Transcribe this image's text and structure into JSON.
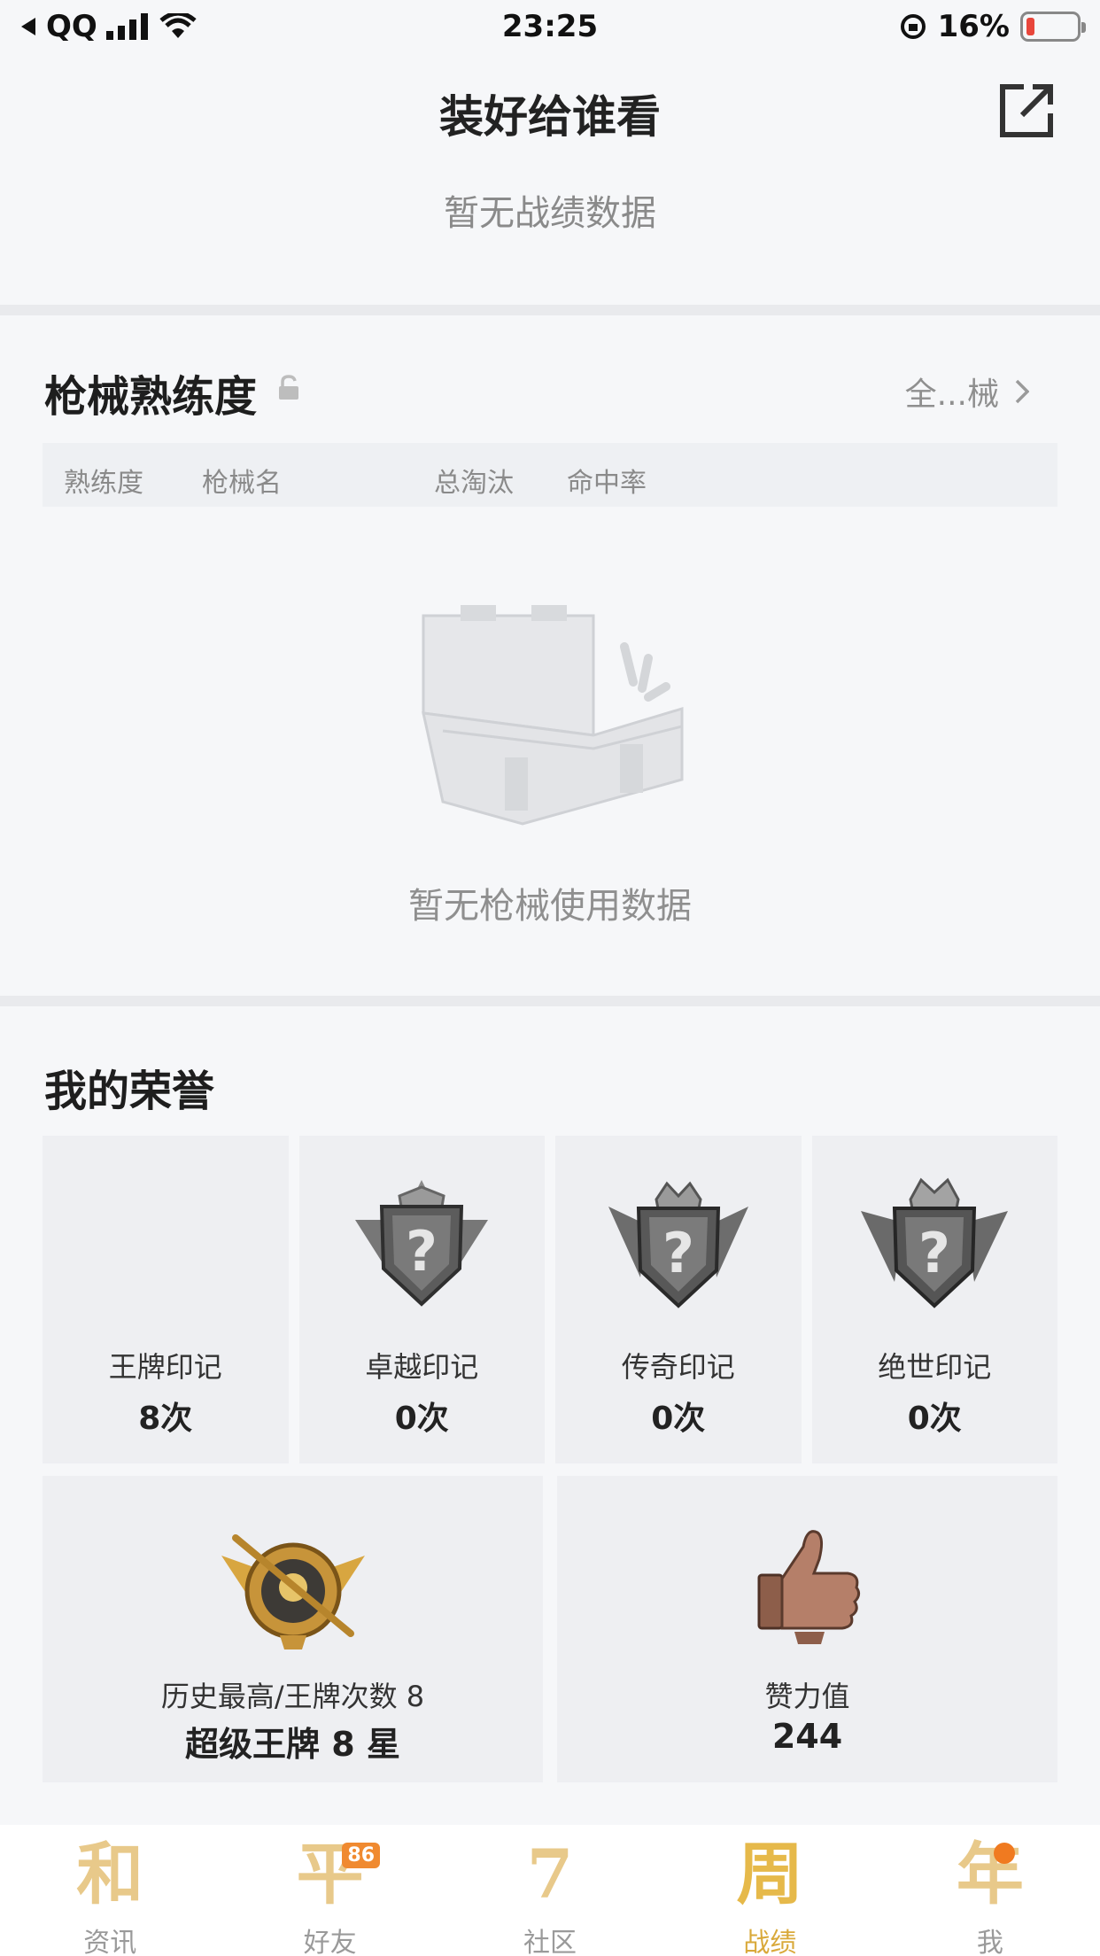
{
  "status_bar": {
    "carrier": "QQ",
    "time": "23:25",
    "battery": "16%"
  },
  "header": {
    "title": "装好给谁看",
    "no_record": "暂无战绩数据"
  },
  "weapon_section": {
    "title": "枪械熟练度",
    "all_link": "全...械",
    "columns": [
      "熟练度",
      "枪械名",
      "总淘汰",
      "命中率"
    ],
    "empty_text": "暂无枪械使用数据"
  },
  "honor_section": {
    "title": "我的荣誉",
    "marks": [
      {
        "label": "王牌印记",
        "count": "8次"
      },
      {
        "label": "卓越印记",
        "count": "0次"
      },
      {
        "label": "传奇印记",
        "count": "0次"
      },
      {
        "label": "绝世印记",
        "count": "0次"
      }
    ],
    "history": {
      "label": "历史最高/王牌次数 8",
      "value": "超级王牌 8 星"
    },
    "praise": {
      "label": "赞力值",
      "value": "244"
    }
  },
  "tab_bar": {
    "tabs": [
      {
        "label": "资讯",
        "glyph": "和",
        "active": false
      },
      {
        "label": "好友",
        "glyph": "平",
        "badge": "86",
        "active": false
      },
      {
        "label": "社区",
        "glyph": "7",
        "active": false
      },
      {
        "label": "战绩",
        "glyph": "周",
        "active": true
      },
      {
        "label": "我",
        "glyph": "年",
        "active": false
      }
    ]
  },
  "colors": {
    "accent": "#d9a93a",
    "battery_low": "#e8463b",
    "badge": "#f08a30"
  }
}
